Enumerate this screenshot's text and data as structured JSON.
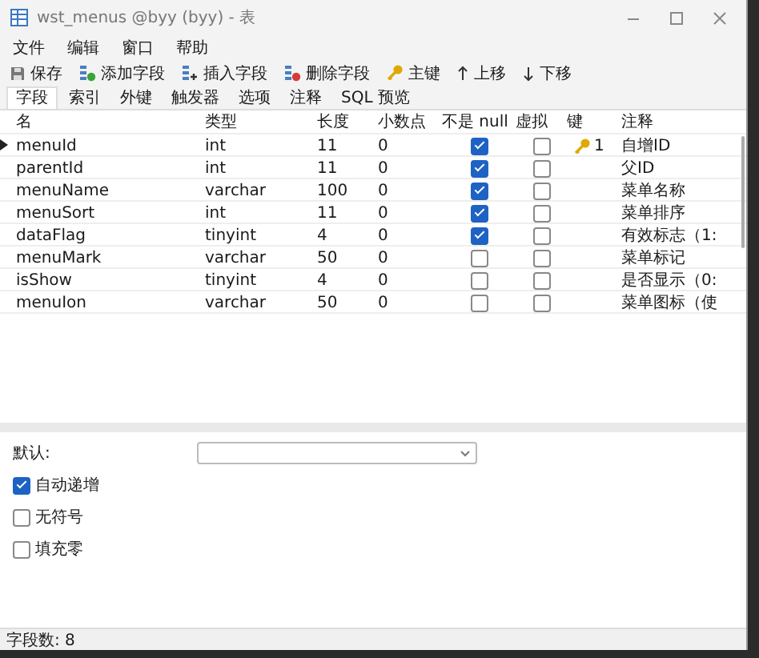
{
  "window": {
    "title": "wst_menus @byy (byy) - 表"
  },
  "menu": [
    "文件",
    "编辑",
    "窗口",
    "帮助"
  ],
  "toolbar": [
    {
      "kind": "save",
      "label": "保存"
    },
    {
      "kind": "add",
      "label": "添加字段"
    },
    {
      "kind": "insert",
      "label": "插入字段"
    },
    {
      "kind": "delete",
      "label": "删除字段"
    },
    {
      "kind": "key",
      "label": "主键"
    },
    {
      "kind": "up",
      "label": "上移"
    },
    {
      "kind": "down",
      "label": "下移"
    }
  ],
  "tabs": [
    {
      "label": "字段",
      "selected": true
    },
    {
      "label": "索引",
      "selected": false
    },
    {
      "label": "外键",
      "selected": false
    },
    {
      "label": "触发器",
      "selected": false
    },
    {
      "label": "选项",
      "selected": false
    },
    {
      "label": "注释",
      "selected": false
    },
    {
      "label": "SQL 预览",
      "selected": false
    }
  ],
  "table": {
    "columns": [
      "名",
      "类型",
      "长度",
      "小数点",
      "不是 null",
      "虚拟",
      "键",
      "注释"
    ],
    "rows": [
      {
        "current": true,
        "name": "menuId",
        "type": "int",
        "length": "11",
        "decimals": "0",
        "not_null": true,
        "virtual": false,
        "key": "1",
        "comment": "自增ID"
      },
      {
        "current": false,
        "name": "parentId",
        "type": "int",
        "length": "11",
        "decimals": "0",
        "not_null": true,
        "virtual": false,
        "key": "",
        "comment": "父ID"
      },
      {
        "current": false,
        "name": "menuName",
        "type": "varchar",
        "length": "100",
        "decimals": "0",
        "not_null": true,
        "virtual": false,
        "key": "",
        "comment": "菜单名称"
      },
      {
        "current": false,
        "name": "menuSort",
        "type": "int",
        "length": "11",
        "decimals": "0",
        "not_null": true,
        "virtual": false,
        "key": "",
        "comment": "菜单排序"
      },
      {
        "current": false,
        "name": "dataFlag",
        "type": "tinyint",
        "length": "4",
        "decimals": "0",
        "not_null": true,
        "virtual": false,
        "key": "",
        "comment": "有效标志（1:"
      },
      {
        "current": false,
        "name": "menuMark",
        "type": "varchar",
        "length": "50",
        "decimals": "0",
        "not_null": false,
        "virtual": false,
        "key": "",
        "comment": "菜单标记"
      },
      {
        "current": false,
        "name": "isShow",
        "type": "tinyint",
        "length": "4",
        "decimals": "0",
        "not_null": false,
        "virtual": false,
        "key": "",
        "comment": "是否显示（0:"
      },
      {
        "current": false,
        "name": "menuIon",
        "type": "varchar",
        "length": "50",
        "decimals": "0",
        "not_null": false,
        "virtual": false,
        "key": "",
        "comment": "菜单图标（使"
      }
    ]
  },
  "properties": {
    "default_label": "默认:",
    "options": [
      {
        "label": "自动递增",
        "checked": true
      },
      {
        "label": "无符号",
        "checked": false
      },
      {
        "label": "填充零",
        "checked": false
      }
    ]
  },
  "status_bar": "字段数: 8"
}
